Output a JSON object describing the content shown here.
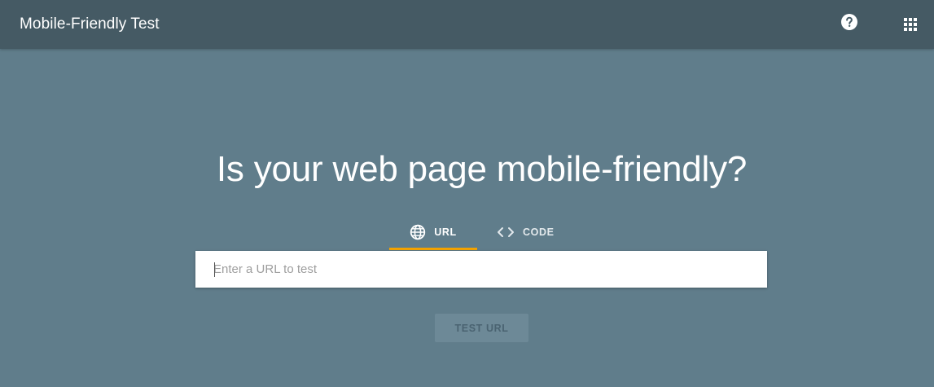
{
  "header": {
    "title": "Mobile-Friendly Test",
    "help_icon": "help-circle-icon",
    "apps_icon": "apps-grid-icon"
  },
  "main": {
    "headline": "Is your web page mobile-friendly?",
    "tabs": [
      {
        "label": "URL",
        "icon": "globe-icon",
        "selected": true
      },
      {
        "label": "CODE",
        "icon": "code-brackets-icon",
        "selected": false
      }
    ],
    "url_input": {
      "value": "",
      "placeholder": "Enter a URL to test"
    },
    "submit_label": "TEST URL",
    "submit_enabled": false
  },
  "colors": {
    "background": "#607d8b",
    "header": "#455a64",
    "tab_indicator": "#f4a300",
    "button_disabled": "#6d8997"
  }
}
